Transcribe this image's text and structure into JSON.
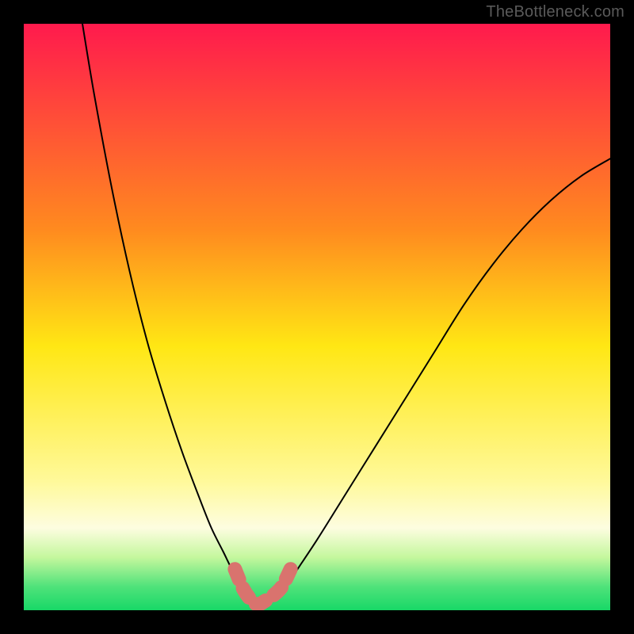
{
  "watermark": "TheBottleneck.com",
  "chart_data": {
    "type": "line",
    "title": "",
    "xlabel": "",
    "ylabel": "",
    "xlim": [
      0,
      100
    ],
    "ylim": [
      0,
      100
    ],
    "series": [
      {
        "name": "bottleneck-curve",
        "x": [
          10,
          12,
          15,
          18,
          21,
          24,
          27,
          30,
          32,
          34,
          36,
          38,
          39,
          40,
          42,
          44,
          46,
          50,
          55,
          60,
          65,
          70,
          75,
          80,
          85,
          90,
          95,
          100
        ],
        "y": [
          100,
          88,
          72,
          58,
          46,
          36,
          27,
          19,
          14,
          10,
          6,
          3,
          1.5,
          1,
          1.5,
          3,
          6,
          12,
          20,
          28,
          36,
          44,
          52,
          59,
          65,
          70,
          74,
          77
        ]
      }
    ],
    "highlight_segment": {
      "name": "sweet-spot-marker",
      "x": [
        36,
        37.5,
        39,
        40,
        41,
        42.5,
        44,
        45.5
      ],
      "y": [
        7,
        3.5,
        1.5,
        1,
        1.5,
        2.5,
        4,
        7
      ]
    },
    "gradient_stops": [
      {
        "offset": 0,
        "color": "#ff1a4d"
      },
      {
        "offset": 35,
        "color": "#ff8a1f"
      },
      {
        "offset": 55,
        "color": "#ffe714"
      },
      {
        "offset": 78,
        "color": "#fff99a"
      },
      {
        "offset": 86,
        "color": "#fdfde0"
      },
      {
        "offset": 91,
        "color": "#c4f79d"
      },
      {
        "offset": 96,
        "color": "#4fe27a"
      },
      {
        "offset": 100,
        "color": "#18d867"
      }
    ],
    "colors": {
      "curve": "#000000",
      "highlight": "#d9736e",
      "frame": "#000000"
    }
  }
}
